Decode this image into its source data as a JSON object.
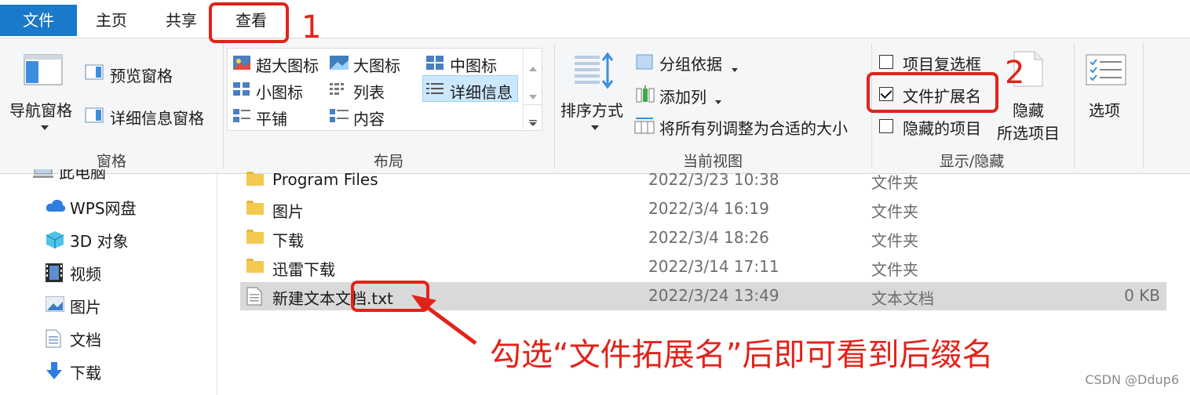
{
  "tabs": {
    "file": "文件",
    "home": "主页",
    "share": "共享",
    "view": "查看"
  },
  "ribbon": {
    "panes": {
      "label": "窗格",
      "nav_pane": "导航窗格",
      "preview_pane": "预览窗格",
      "details_pane": "详细信息窗格"
    },
    "layout": {
      "label": "布局",
      "items": [
        "超大图标",
        "大图标",
        "中图标",
        "小图标",
        "列表",
        "详细信息",
        "平铺",
        "内容"
      ],
      "selected": "详细信息"
    },
    "current_view": {
      "label": "当前视图",
      "sort_by": "排序方式",
      "group_by": "分组依据",
      "add_columns": "添加列",
      "size_all_columns": "将所有列调整为合适的大小"
    },
    "show_hide": {
      "label": "显示/隐藏",
      "item_checkboxes": "项目复选框",
      "file_extensions": "文件扩展名",
      "hidden_items": "隐藏的项目",
      "hide_selected_line1": "隐藏",
      "hide_selected_line2": "所选项目",
      "item_checkboxes_checked": false,
      "file_extensions_checked": true,
      "hidden_items_checked": false
    },
    "options": {
      "label": "选项"
    }
  },
  "nav": {
    "partial_top": "此电脑",
    "items": [
      "WPS网盘",
      "3D 对象",
      "视频",
      "图片",
      "文档",
      "下载"
    ]
  },
  "files": [
    {
      "name": "Program Files",
      "date": "2022/3/23 10:38",
      "type": "文件夹",
      "size": ""
    },
    {
      "name": "图片",
      "date": "2022/3/4 16:19",
      "type": "文件夹",
      "size": ""
    },
    {
      "name": "下载",
      "date": "2022/3/4 18:26",
      "type": "文件夹",
      "size": ""
    },
    {
      "name": "迅雷下载",
      "date": "2022/3/14 17:11",
      "type": "文件夹",
      "size": ""
    },
    {
      "name": "新建文本文档.txt",
      "date": "2022/3/24 13:49",
      "type": "文本文档",
      "size": "0 KB"
    }
  ],
  "annotations": {
    "step1": "1",
    "step2": "2",
    "note": "勾选“文件拓展名”后即可看到后缀名",
    "color": "#e2231a"
  },
  "watermark": "CSDN @Ddup6",
  "colors": {
    "file_tab": "#1979ca",
    "ribbon_bg": "#f5f6f7",
    "selected_row": "#d9d9d9"
  }
}
